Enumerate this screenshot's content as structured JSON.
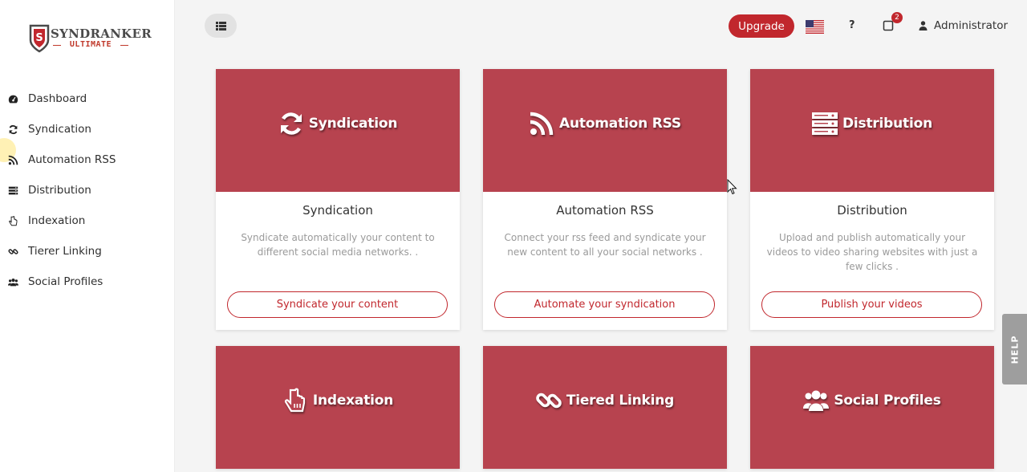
{
  "brand": {
    "name": "SYNDRANKER",
    "tagline": "ULTIMATE",
    "accent": "#c1272d"
  },
  "sidebar": {
    "items": [
      {
        "label": "Dashboard",
        "icon": "dashboard-icon"
      },
      {
        "label": "Syndication",
        "icon": "refresh-icon"
      },
      {
        "label": "Automation RSS",
        "icon": "rss-icon"
      },
      {
        "label": "Distribution",
        "icon": "server-icon"
      },
      {
        "label": "Indexation",
        "icon": "pointer-hand-icon"
      },
      {
        "label": "Tierer Linking",
        "icon": "link-icon"
      },
      {
        "label": "Social Profiles",
        "icon": "users-icon"
      }
    ]
  },
  "header": {
    "upgrade_label": "Upgrade",
    "help_glyph": "?",
    "notification_count": "2",
    "user_name": "Administrator",
    "language": "us-flag-icon"
  },
  "cards": [
    {
      "head_title": "Syndication",
      "icon": "refresh-icon",
      "title": "Syndication",
      "description": "Syndicate automatically your content to different social media networks. .",
      "button": "Syndicate your content"
    },
    {
      "head_title": "Automation RSS",
      "icon": "rss-icon",
      "title": "Automation RSS",
      "description": "Connect your rss feed and syndicate your new content to all your social networks .",
      "button": "Automate your syndication"
    },
    {
      "head_title": "Distribution",
      "icon": "server-icon",
      "title": "Distribution",
      "description": "Upload and publish automatically your videos to video sharing websites with just a few clicks .",
      "button": "Publish your videos"
    },
    {
      "head_title": "Indexation",
      "icon": "pointer-hand-icon"
    },
    {
      "head_title": "Tiered Linking",
      "icon": "link-icon"
    },
    {
      "head_title": "Social Profiles",
      "icon": "users-icon"
    }
  ],
  "help_tab": "HELP"
}
